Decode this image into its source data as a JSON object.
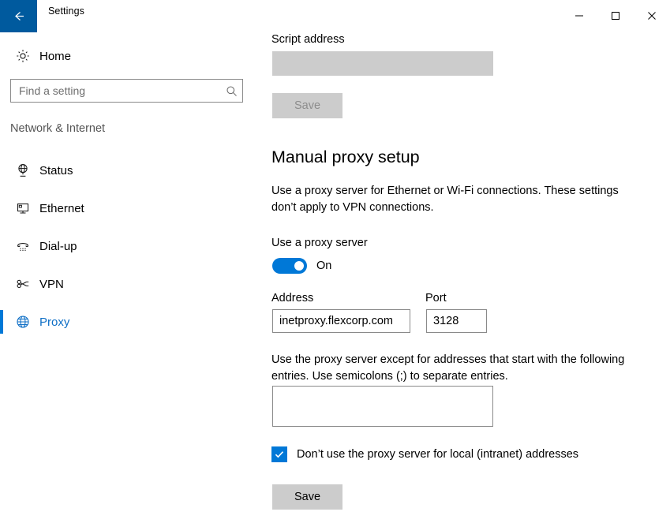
{
  "window": {
    "title": "Settings",
    "back_icon": "back-arrow-icon",
    "minimize_label": "—",
    "maximize_label": "☐",
    "close_label": "✕"
  },
  "sidebar": {
    "home_label": "Home",
    "home_icon": "gear-icon",
    "search": {
      "placeholder": "Find a setting",
      "value": "",
      "icon": "search-icon"
    },
    "category_heading": "Network & Internet",
    "items": [
      {
        "label": "Status",
        "icon": "globe-status-icon",
        "selected": false
      },
      {
        "label": "Ethernet",
        "icon": "ethernet-icon",
        "selected": false
      },
      {
        "label": "Dial-up",
        "icon": "dial-up-icon",
        "selected": false
      },
      {
        "label": "VPN",
        "icon": "vpn-icon",
        "selected": false
      },
      {
        "label": "Proxy",
        "icon": "globe-proxy-icon",
        "selected": true
      }
    ]
  },
  "main": {
    "script_address": {
      "label": "Script address",
      "value": "",
      "enabled": false
    },
    "script_save_label": "Save",
    "manual_setup": {
      "title": "Manual proxy setup",
      "description": "Use a proxy server for Ethernet or Wi-Fi connections. These settings don’t apply to VPN connections.",
      "toggle_label": "Use a proxy server",
      "toggle_state": "On",
      "address_label": "Address",
      "address_value": "inetproxy.flexcorp.com",
      "port_label": "Port",
      "port_value": "3128",
      "exceptions_description": "Use the proxy server except for addresses that start with the following entries. Use semicolons (;) to separate entries.",
      "exceptions_value": "",
      "local_bypass_label": "Don’t use the proxy server for local (intranet) addresses",
      "save_label": "Save"
    }
  },
  "colors": {
    "accent": "#0078d7",
    "titlebar_back": "#005a9e",
    "selected_text": "#0f6fc6",
    "disabled_fill": "#cccccc",
    "border": "#8a8a8a"
  }
}
